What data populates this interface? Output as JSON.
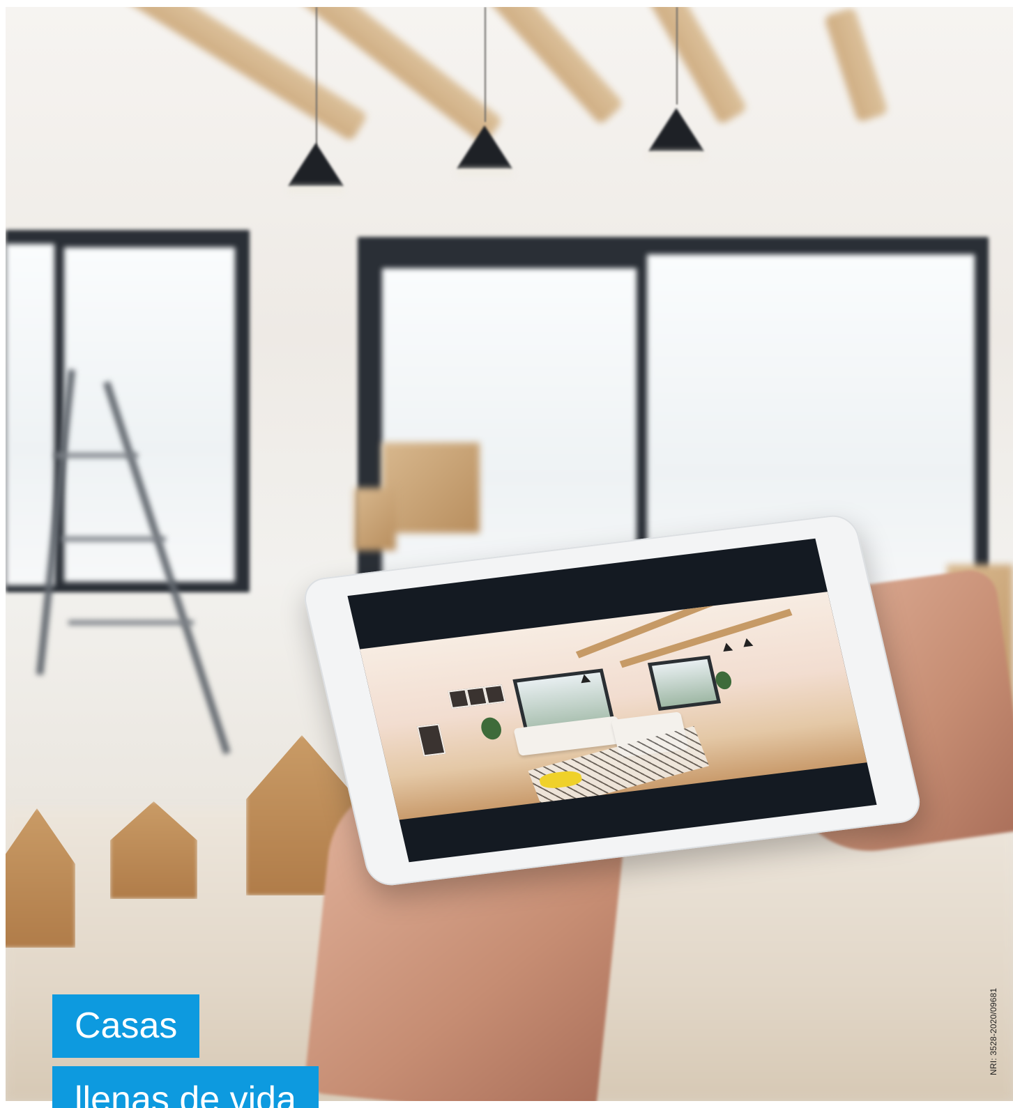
{
  "scene": {
    "description_icon": "photo-person-holding-tablet-in-empty-house",
    "colors": {
      "label_background": "#0d9adf",
      "label_text": "#ffffff",
      "wood": "#c9a270",
      "window_frame": "#2a2f36"
    }
  },
  "headline": {
    "line1": "Casas",
    "line2": "llenas de vida"
  },
  "registration": "NRI: 3528-2020/09681"
}
